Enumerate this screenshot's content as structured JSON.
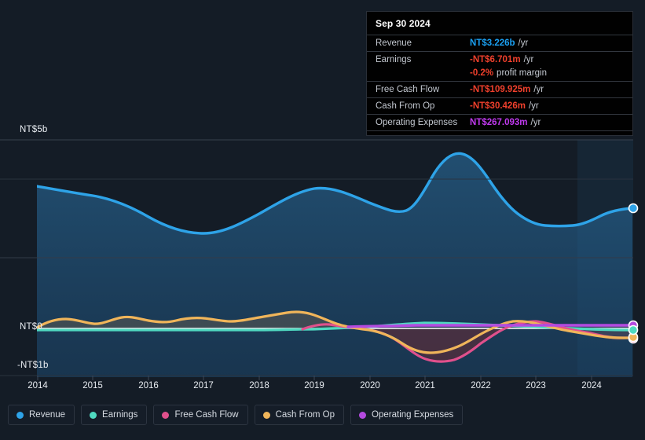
{
  "chart_data": {
    "type": "area",
    "title": "",
    "xlabel": "",
    "ylabel": "",
    "currency": "NT$",
    "grid": true,
    "legend_position": "bottom-left",
    "ylim": [
      -1000000000,
      5000000000
    ],
    "y_ticks": [
      {
        "label": "NT$5b",
        "value": 5000000000
      },
      {
        "label": "NT$0",
        "value": 0
      },
      {
        "label": "-NT$1b",
        "value": -1000000000
      }
    ],
    "x_ticks": [
      "2014",
      "2015",
      "2016",
      "2017",
      "2018",
      "2019",
      "2020",
      "2021",
      "2022",
      "2023",
      "2024"
    ],
    "x_range": [
      2013.75,
      2024.75
    ],
    "series": [
      {
        "name": "Revenue",
        "color": "#2ea3e8",
        "unit": "b",
        "x": [
          2013.75,
          2014.25,
          2014.75,
          2015.25,
          2015.75,
          2016.25,
          2016.75,
          2017.25,
          2017.75,
          2018.25,
          2018.75,
          2019.25,
          2019.75,
          2020.25,
          2020.75,
          2021.25,
          2021.75,
          2022.0,
          2022.5,
          2023.0,
          2023.5,
          2024.0,
          2024.75
        ],
        "values": [
          3.77,
          3.62,
          3.46,
          3.21,
          2.95,
          2.74,
          2.72,
          2.9,
          3.2,
          3.5,
          3.71,
          3.69,
          3.45,
          3.3,
          3.28,
          3.75,
          4.55,
          4.67,
          4.1,
          3.45,
          3.19,
          3.18,
          3.226
        ]
      },
      {
        "name": "Earnings",
        "color": "#4fd9c0",
        "unit": "m",
        "x": [
          2013.75,
          2014.75,
          2015.75,
          2016.75,
          2017.75,
          2018.75,
          2019.75,
          2020.75,
          2021.75,
          2022.5,
          2023.5,
          2024.75
        ],
        "values": [
          -26,
          -30,
          -31,
          -32,
          -33,
          -34,
          -22,
          18,
          32,
          -5,
          -12,
          -6.701
        ]
      },
      {
        "name": "Free Cash Flow",
        "color": "#e0508c",
        "unit": "m",
        "x": [
          2018.75,
          2019.25,
          2019.75,
          2020.25,
          2020.75,
          2021.25,
          2021.75,
          2022.25,
          2022.75,
          2023.25,
          2023.75,
          2024.25,
          2024.75
        ],
        "values": [
          48,
          62,
          30,
          -12,
          -190,
          -400,
          -430,
          -150,
          95,
          60,
          -30,
          -90,
          -109.925
        ]
      },
      {
        "name": "Cash From Op",
        "color": "#f0b martinez",
        "unit": "m",
        "x": [
          2013.75,
          2014.25,
          2014.75,
          2015.25,
          2015.75,
          2016.25,
          2016.75,
          2017.25,
          2017.75,
          2018.25,
          2018.75,
          2019.25,
          2019.75,
          2020.25,
          2020.75,
          2021.25,
          2021.75,
          2022.25,
          2022.75,
          2023.25,
          2023.75,
          2024.25,
          2024.75
        ],
        "values": [
          5,
          70,
          78,
          55,
          88,
          75,
          60,
          88,
          60,
          72,
          110,
          120,
          50,
          -20,
          -170,
          -300,
          -290,
          -60,
          128,
          108,
          30,
          -15,
          -30.426
        ]
      },
      {
        "name": "Operating Expenses",
        "color": "#b44ae0",
        "unit": "m",
        "x": [
          2019.75,
          2020.75,
          2021.75,
          2022.75,
          2023.75,
          2024.75
        ],
        "values": [
          190,
          230,
          250,
          262,
          265,
          267.093
        ]
      }
    ]
  },
  "tooltip": {
    "date": "Sep 30 2024",
    "rows": [
      {
        "label": "Revenue",
        "value": "NT$3.226b",
        "unit": "/yr",
        "color": "#1ba0f2"
      },
      {
        "label": "Earnings",
        "value": "-NT$6.701m",
        "unit": "/yr",
        "color": "#f0402c"
      },
      {
        "label": "",
        "value": "-0.2%",
        "unit": "profit margin",
        "color": "#f0402c",
        "sub": true
      },
      {
        "label": "Free Cash Flow",
        "value": "-NT$109.925m",
        "unit": "/yr",
        "color": "#f0402c"
      },
      {
        "label": "Cash From Op",
        "value": "-NT$30.426m",
        "unit": "/yr",
        "color": "#f0402c"
      },
      {
        "label": "Operating Expenses",
        "value": "NT$267.093m",
        "unit": "/yr",
        "color": "#c13af0"
      }
    ]
  },
  "legend": {
    "items": [
      {
        "label": "Revenue",
        "color": "#2ea3e8"
      },
      {
        "label": "Earnings",
        "color": "#4fd9c0"
      },
      {
        "label": "Free Cash Flow",
        "color": "#e0508c"
      },
      {
        "label": "Cash From Op",
        "color": "#f0b55a"
      },
      {
        "label": "Operating Expenses",
        "color": "#b44ae0"
      }
    ]
  },
  "axis": {
    "y_labels": [
      "NT$5b",
      "NT$0",
      "-NT$1b"
    ],
    "x_labels": [
      "2014",
      "2015",
      "2016",
      "2017",
      "2018",
      "2019",
      "2020",
      "2021",
      "2022",
      "2023",
      "2024"
    ]
  }
}
